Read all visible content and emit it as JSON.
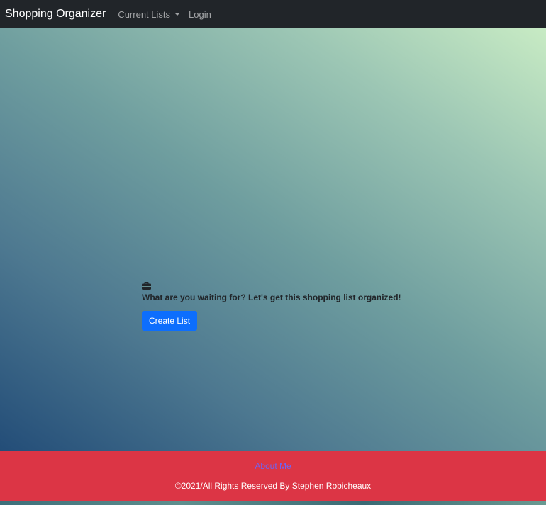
{
  "navbar": {
    "brand": "Shopping Organizer",
    "items": [
      {
        "label": "Current Lists",
        "dropdown": true
      },
      {
        "label": "Login",
        "dropdown": false
      }
    ]
  },
  "hero": {
    "icon": "briefcase-icon",
    "message": "What are you waiting for? Let's get this shopping list organized!",
    "button_label": "Create List"
  },
  "footer": {
    "about_link": "About Me",
    "copyright": "©2021/All Rights Reserved By Stephen Robicheaux"
  },
  "colors": {
    "navbar": "#212529",
    "primary_button": "#0d6efd",
    "footer": "#dc3545"
  }
}
